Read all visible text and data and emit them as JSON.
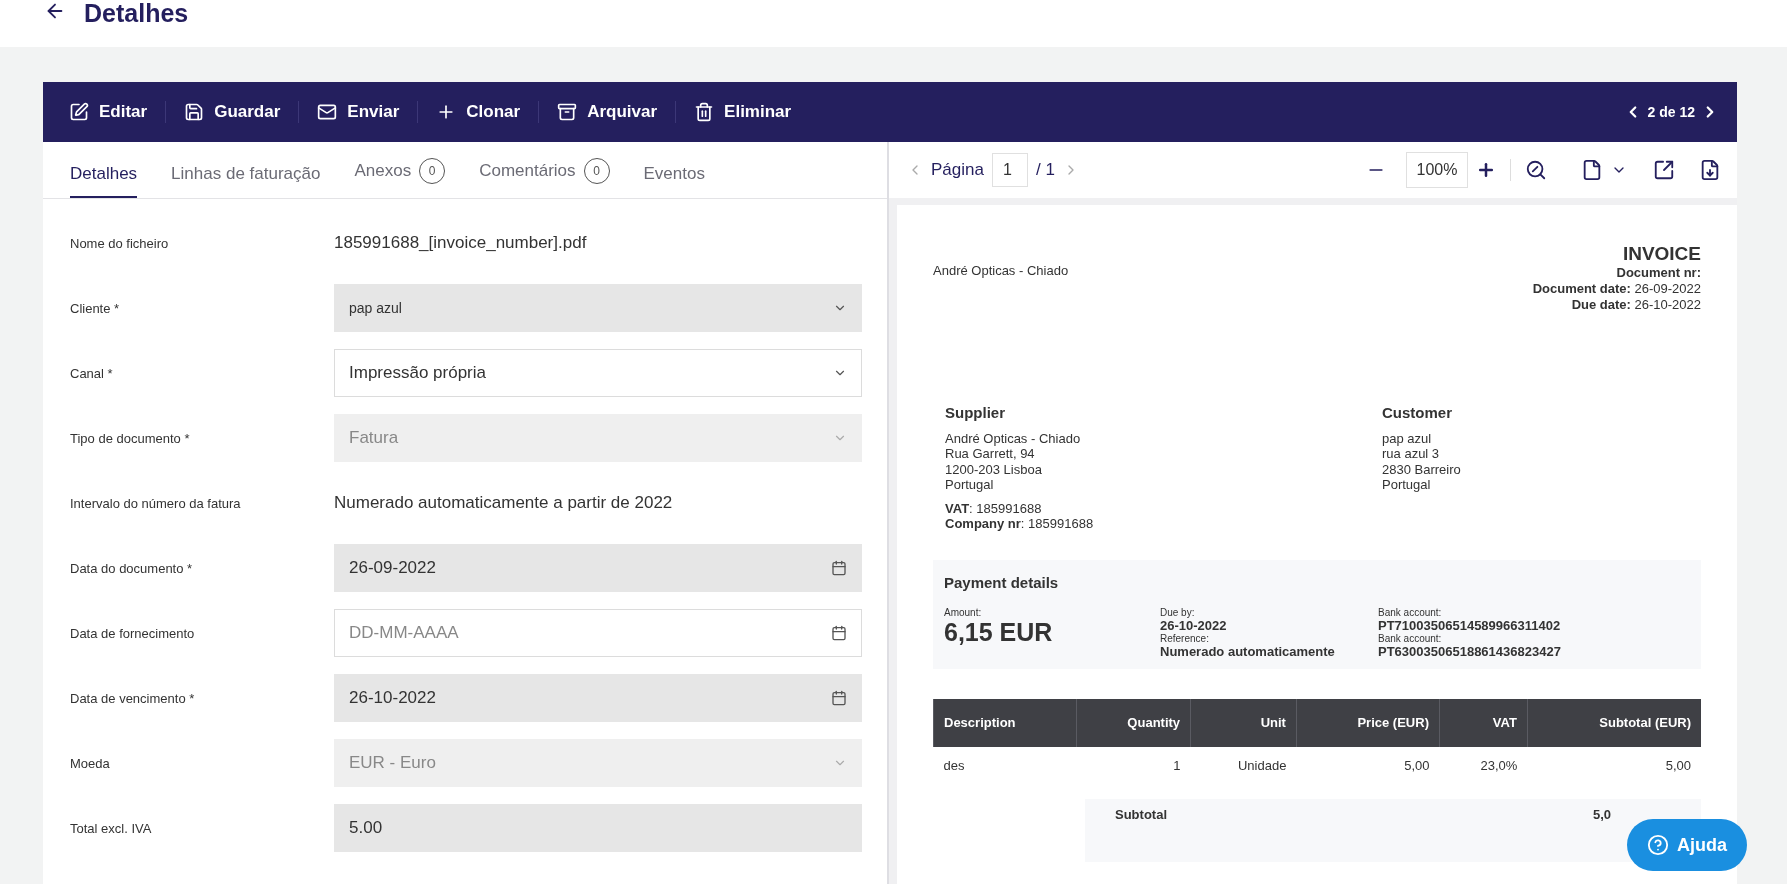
{
  "header": {
    "title": "Detalhes"
  },
  "toolbar": {
    "actions": [
      {
        "kind": "edit",
        "label": "Editar"
      },
      {
        "kind": "save",
        "label": "Guardar"
      },
      {
        "kind": "send",
        "label": "Enviar"
      },
      {
        "kind": "clone",
        "label": "Clonar"
      },
      {
        "kind": "archive",
        "label": "Arquivar"
      },
      {
        "kind": "delete",
        "label": "Eliminar"
      }
    ],
    "pager": "2 de 12"
  },
  "tabs": [
    {
      "label": "Detalhes",
      "selected": true
    },
    {
      "label": "Linhas de faturação",
      "selected": false
    },
    {
      "label": "Anexos",
      "count": "0",
      "selected": false
    },
    {
      "label": "Comentários",
      "count": "0",
      "selected": false
    },
    {
      "label": "Eventos",
      "selected": false
    }
  ],
  "form": {
    "rows": [
      {
        "label": "Nome do ficheiro",
        "kind": "text",
        "value": "185991688_[invoice_number].pdf"
      },
      {
        "label": "Cliente *",
        "kind": "select",
        "readonly": true,
        "disabled": false,
        "small": true,
        "value": "pap azul"
      },
      {
        "label": "Canal *",
        "kind": "select",
        "readonly": false,
        "disabled": false,
        "value": "Impressão própria"
      },
      {
        "label": "Tipo de documento *",
        "kind": "select",
        "readonly": false,
        "disabled": true,
        "value": "Fatura"
      },
      {
        "label": "Intervalo do número da fatura",
        "kind": "text",
        "value": "Numerado automaticamente a partir de 2022"
      },
      {
        "label": "Data do documento *",
        "kind": "date",
        "readonly": true,
        "disabled": false,
        "value": "26-09-2022"
      },
      {
        "label": "Data de fornecimento",
        "kind": "date",
        "readonly": false,
        "disabled": false,
        "placeholder": "DD-MM-AAAA"
      },
      {
        "label": "Data de vencimento *",
        "kind": "date",
        "readonly": true,
        "disabled": false,
        "value": "26-10-2022"
      },
      {
        "label": "Moeda",
        "kind": "select",
        "readonly": false,
        "disabled": true,
        "value": "EUR - Euro"
      },
      {
        "label": "Total excl. IVA",
        "kind": "input",
        "readonly": true,
        "disabled": false,
        "value": "5.00"
      }
    ]
  },
  "viewer": {
    "page_label": "Página",
    "page": "1",
    "page_total": "/ 1",
    "zoom": "100%"
  },
  "invoice": {
    "company": "André Opticas - Chiado",
    "title": "INVOICE",
    "meta": [
      {
        "label": "Document nr:"
      },
      {
        "label": "Document date:",
        "value": "26-09-2022"
      },
      {
        "label": "Due date:",
        "value": "26-10-2022"
      }
    ],
    "parties": [
      {
        "heading": "Supplier",
        "lines": [
          "André Opticas - Chiado",
          "Rua Garrett, 94",
          "1200-203 Lisboa",
          "Portugal"
        ],
        "ids": [
          "**VAT**: 185991688",
          "**Company nr**: 185991688"
        ]
      },
      {
        "heading": "Customer",
        "lines": [
          "pap azul",
          "rua azul 3",
          "2830 Barreiro",
          "Portugal"
        ]
      }
    ],
    "payment": {
      "title": "Payment details",
      "amount_label": "Amount:",
      "amount": "6,15 EUR",
      "fields": [
        [
          {
            "label": "Due by:",
            "value": "26-10-2022"
          },
          {
            "label": "Reference:",
            "value": "Numerado automaticamente"
          }
        ],
        [
          {
            "label": "Bank account:",
            "value": "PT71003506514589966311402"
          },
          {
            "label": "Bank account:",
            "value": "PT63003506518861436823427"
          }
        ]
      ]
    },
    "table": {
      "columns": [
        "Description",
        "Quantity",
        "Unit",
        "Price (EUR)",
        "VAT",
        "Subtotal (EUR)"
      ],
      "rows": [
        [
          "des",
          "1",
          "Unidade",
          "5,00",
          "23,0%",
          "5,00"
        ]
      ]
    },
    "totals": [
      {
        "label": "Subtotal",
        "value": "5,0"
      }
    ]
  },
  "help": {
    "label": "Ajuda"
  }
}
